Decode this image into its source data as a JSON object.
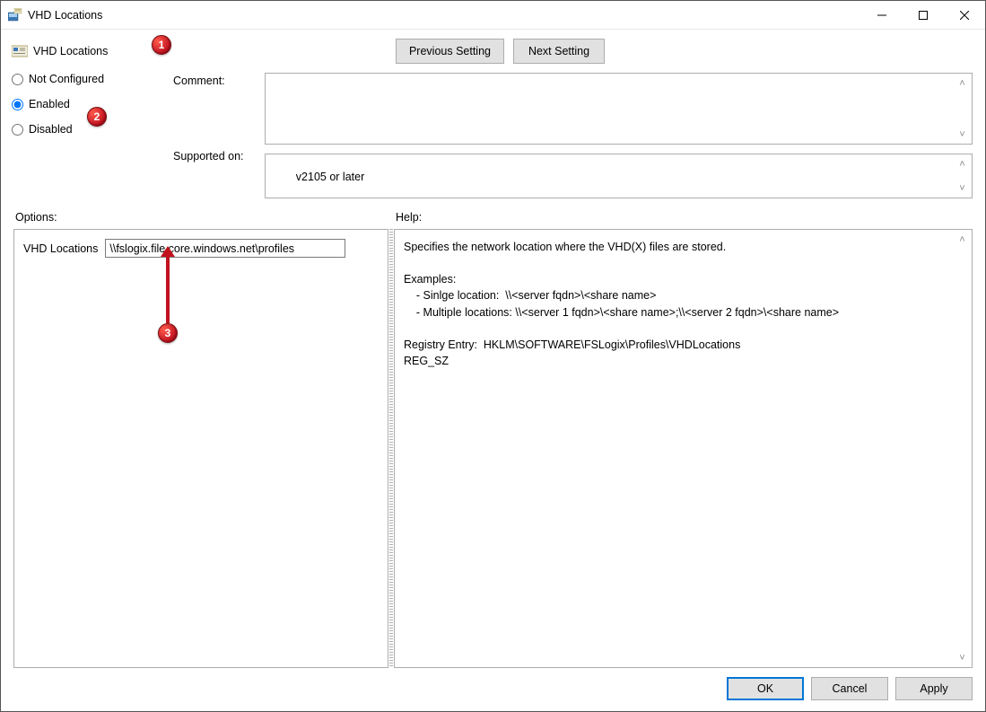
{
  "window": {
    "title": "VHD Locations"
  },
  "header": {
    "title": "VHD Locations",
    "prev_label": "Previous Setting",
    "next_label": "Next Setting"
  },
  "state": {
    "options": [
      "Not Configured",
      "Enabled",
      "Disabled"
    ],
    "selected_index": 1,
    "not_configured": "Not Configured",
    "enabled": "Enabled",
    "disabled": "Disabled"
  },
  "labels": {
    "comment": "Comment:",
    "supported_on": "Supported on:",
    "options": "Options:",
    "help": "Help:"
  },
  "fields": {
    "comment": "",
    "supported_on": "v2105 or later"
  },
  "options_pane": {
    "vhd_locations_label": "VHD Locations",
    "vhd_locations_value": "\\\\fslogix.file.core.windows.net\\profiles"
  },
  "help_text": "Specifies the network location where the VHD(X) files are stored.\n\nExamples:\n    - Sinlge location:  \\\\<server fqdn>\\<share name>\n    - Multiple locations: \\\\<server 1 fqdn>\\<share name>;\\\\<server 2 fqdn>\\<share name>\n\nRegistry Entry:  HKLM\\SOFTWARE\\FSLogix\\Profiles\\VHDLocations\nREG_SZ",
  "footer": {
    "ok": "OK",
    "cancel": "Cancel",
    "apply": "Apply"
  },
  "callouts": {
    "c1": "1",
    "c2": "2",
    "c3": "3"
  }
}
